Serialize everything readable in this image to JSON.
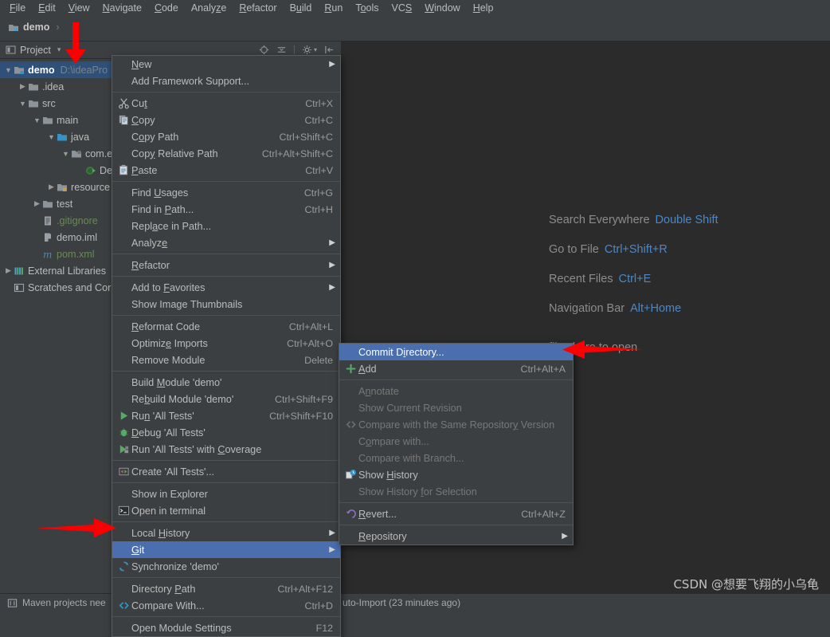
{
  "menubar": {
    "items": [
      "File",
      "Edit",
      "View",
      "Navigate",
      "Code",
      "Analyze",
      "Refactor",
      "Build",
      "Run",
      "Tools",
      "VCS",
      "Window",
      "Help"
    ]
  },
  "breadcrumb": {
    "project": "demo",
    "separator": "›"
  },
  "toolwindow": {
    "title": "Project",
    "dropdown_caret": "▾",
    "icons": [
      "locate-icon",
      "collapse-all-icon",
      "settings-gear-icon",
      "hide-icon"
    ]
  },
  "tree": [
    {
      "indent": 0,
      "twisty": "▼",
      "icon": "module-icon",
      "label": "demo",
      "path": "D:\\ideaPro",
      "selected": true,
      "bold": true
    },
    {
      "indent": 1,
      "twisty": "▶",
      "icon": "folder-icon",
      "label": ".idea",
      "path": "",
      "selected": false,
      "bold": false
    },
    {
      "indent": 1,
      "twisty": "▼",
      "icon": "folder-icon",
      "label": "src",
      "path": "",
      "selected": false,
      "bold": false
    },
    {
      "indent": 2,
      "twisty": "▼",
      "icon": "folder-icon",
      "label": "main",
      "path": "",
      "selected": false,
      "bold": false
    },
    {
      "indent": 3,
      "twisty": "▼",
      "icon": "source-folder-icon",
      "label": "java",
      "path": "",
      "selected": false,
      "bold": false
    },
    {
      "indent": 4,
      "twisty": "▼",
      "icon": "package-icon",
      "label": "com.e",
      "path": "",
      "selected": false,
      "bold": false
    },
    {
      "indent": 5,
      "twisty": "",
      "icon": "java-class-run-icon",
      "label": "De",
      "path": "",
      "selected": false,
      "bold": false
    },
    {
      "indent": 3,
      "twisty": "▶",
      "icon": "resources-folder-icon",
      "label": "resource",
      "path": "",
      "selected": false,
      "bold": false
    },
    {
      "indent": 2,
      "twisty": "▶",
      "icon": "folder-icon",
      "label": "test",
      "path": "",
      "selected": false,
      "bold": false
    },
    {
      "indent": 2,
      "twisty": "",
      "icon": "gitignore-file-icon",
      "label": ".gitignore",
      "path": "",
      "selected": false,
      "bold": false
    },
    {
      "indent": 2,
      "twisty": "",
      "icon": "iml-file-icon",
      "label": "demo.iml",
      "path": "",
      "selected": false,
      "bold": false
    },
    {
      "indent": 2,
      "twisty": "",
      "icon": "maven-pom-icon",
      "label": "pom.xml",
      "path": "",
      "selected": false,
      "bold": false
    },
    {
      "indent": 0,
      "twisty": "▶",
      "icon": "external-libraries-icon",
      "label": "External Libraries",
      "path": "",
      "selected": false,
      "bold": false
    },
    {
      "indent": 0,
      "twisty": "",
      "icon": "scratches-icon",
      "label": "Scratches and Cor",
      "path": "",
      "selected": false,
      "bold": false
    }
  ],
  "editor_hints": [
    {
      "label": "Search Everywhere",
      "key": "Double Shift"
    },
    {
      "label": "Go to File",
      "key": "Ctrl+Shift+R"
    },
    {
      "label": "Recent Files",
      "key": "Ctrl+E"
    },
    {
      "label": "Navigation Bar",
      "key": "Alt+Home"
    }
  ],
  "drop_hint": "files here to open",
  "context_menu": {
    "groups": [
      [
        {
          "icon": "",
          "label": "New",
          "accel": "",
          "submenu": true,
          "disabled": false,
          "highlighted": false,
          "mnemonic": 0
        },
        {
          "icon": "",
          "label": "Add Framework Support...",
          "accel": "",
          "submenu": false,
          "disabled": false,
          "highlighted": false,
          "mnemonic": -1
        }
      ],
      [
        {
          "icon": "cut-icon",
          "label": "Cut",
          "accel": "Ctrl+X",
          "submenu": false,
          "disabled": false,
          "highlighted": false,
          "mnemonic": 2
        },
        {
          "icon": "copy-icon",
          "label": "Copy",
          "accel": "Ctrl+C",
          "submenu": false,
          "disabled": false,
          "highlighted": false,
          "mnemonic": 0
        },
        {
          "icon": "",
          "label": "Copy Path",
          "accel": "Ctrl+Shift+C",
          "submenu": false,
          "disabled": false,
          "highlighted": false,
          "mnemonic": 1
        },
        {
          "icon": "",
          "label": "Copy Relative Path",
          "accel": "Ctrl+Alt+Shift+C",
          "submenu": false,
          "disabled": false,
          "highlighted": false,
          "mnemonic": 3
        },
        {
          "icon": "paste-icon",
          "label": "Paste",
          "accel": "Ctrl+V",
          "submenu": false,
          "disabled": false,
          "highlighted": false,
          "mnemonic": 0
        }
      ],
      [
        {
          "icon": "",
          "label": "Find Usages",
          "accel": "Ctrl+G",
          "submenu": false,
          "disabled": false,
          "highlighted": false,
          "mnemonic": 5
        },
        {
          "icon": "",
          "label": "Find in Path...",
          "accel": "Ctrl+H",
          "submenu": false,
          "disabled": false,
          "highlighted": false,
          "mnemonic": 8
        },
        {
          "icon": "",
          "label": "Replace in Path...",
          "accel": "",
          "submenu": false,
          "disabled": false,
          "highlighted": false,
          "mnemonic": 4
        },
        {
          "icon": "",
          "label": "Analyze",
          "accel": "",
          "submenu": true,
          "disabled": false,
          "highlighted": false,
          "mnemonic": 6
        }
      ],
      [
        {
          "icon": "",
          "label": "Refactor",
          "accel": "",
          "submenu": true,
          "disabled": false,
          "highlighted": false,
          "mnemonic": 0
        }
      ],
      [
        {
          "icon": "",
          "label": "Add to Favorites",
          "accel": "",
          "submenu": true,
          "disabled": false,
          "highlighted": false,
          "mnemonic": 7
        },
        {
          "icon": "",
          "label": "Show Image Thumbnails",
          "accel": "",
          "submenu": false,
          "disabled": false,
          "highlighted": false,
          "mnemonic": -1
        }
      ],
      [
        {
          "icon": "",
          "label": "Reformat Code",
          "accel": "Ctrl+Alt+L",
          "submenu": false,
          "disabled": false,
          "highlighted": false,
          "mnemonic": 0
        },
        {
          "icon": "",
          "label": "Optimize Imports",
          "accel": "Ctrl+Alt+O",
          "submenu": false,
          "disabled": false,
          "highlighted": false,
          "mnemonic": 7
        },
        {
          "icon": "",
          "label": "Remove Module",
          "accel": "Delete",
          "submenu": false,
          "disabled": false,
          "highlighted": false,
          "mnemonic": -1
        }
      ],
      [
        {
          "icon": "",
          "label": "Build Module 'demo'",
          "accel": "",
          "submenu": false,
          "disabled": false,
          "highlighted": false,
          "mnemonic": 6
        },
        {
          "icon": "",
          "label": "Rebuild Module 'demo'",
          "accel": "Ctrl+Shift+F9",
          "submenu": false,
          "disabled": false,
          "highlighted": false,
          "mnemonic": 2
        },
        {
          "icon": "run-icon",
          "label": "Run 'All Tests'",
          "accel": "Ctrl+Shift+F10",
          "submenu": false,
          "disabled": false,
          "highlighted": false,
          "mnemonic": 2
        },
        {
          "icon": "debug-icon",
          "label": "Debug 'All Tests'",
          "accel": "",
          "submenu": false,
          "disabled": false,
          "highlighted": false,
          "mnemonic": 0
        },
        {
          "icon": "coverage-icon",
          "label": "Run 'All Tests' with Coverage",
          "accel": "",
          "submenu": false,
          "disabled": false,
          "highlighted": false,
          "mnemonic": 21
        }
      ],
      [
        {
          "icon": "create-config-icon",
          "label": "Create 'All Tests'...",
          "accel": "",
          "submenu": false,
          "disabled": false,
          "highlighted": false,
          "mnemonic": -1
        }
      ],
      [
        {
          "icon": "",
          "label": "Show in Explorer",
          "accel": "",
          "submenu": false,
          "disabled": false,
          "highlighted": false,
          "mnemonic": -1
        },
        {
          "icon": "terminal-icon",
          "label": "Open in terminal",
          "accel": "",
          "submenu": false,
          "disabled": false,
          "highlighted": false,
          "mnemonic": -1
        }
      ],
      [
        {
          "icon": "",
          "label": "Local History",
          "accel": "",
          "submenu": true,
          "disabled": false,
          "highlighted": false,
          "mnemonic": 6
        },
        {
          "icon": "",
          "label": "Git",
          "accel": "",
          "submenu": true,
          "disabled": false,
          "highlighted": true,
          "mnemonic": 0
        },
        {
          "icon": "synchronize-icon",
          "label": "Synchronize 'demo'",
          "accel": "",
          "submenu": false,
          "disabled": false,
          "highlighted": false,
          "mnemonic": -1
        }
      ],
      [
        {
          "icon": "",
          "label": "Directory Path",
          "accel": "Ctrl+Alt+F12",
          "submenu": false,
          "disabled": false,
          "highlighted": false,
          "mnemonic": 10
        },
        {
          "icon": "compare-icon",
          "label": "Compare With...",
          "accel": "Ctrl+D",
          "submenu": false,
          "disabled": false,
          "highlighted": false,
          "mnemonic": -1
        }
      ],
      [
        {
          "icon": "",
          "label": "Open Module Settings",
          "accel": "F12",
          "submenu": false,
          "disabled": false,
          "highlighted": false,
          "mnemonic": -1
        }
      ]
    ]
  },
  "git_submenu": {
    "groups": [
      [
        {
          "icon": "",
          "label": "Commit Directory...",
          "accel": "",
          "submenu": false,
          "disabled": false,
          "highlighted": true,
          "mnemonic": 8
        },
        {
          "icon": "add-icon",
          "label": "Add",
          "accel": "Ctrl+Alt+A",
          "submenu": false,
          "disabled": false,
          "highlighted": false,
          "mnemonic": 0
        }
      ],
      [
        {
          "icon": "",
          "label": "Annotate",
          "accel": "",
          "submenu": false,
          "disabled": true,
          "highlighted": false,
          "mnemonic": 1
        },
        {
          "icon": "",
          "label": "Show Current Revision",
          "accel": "",
          "submenu": false,
          "disabled": true,
          "highlighted": false,
          "mnemonic": -1
        },
        {
          "icon": "compare-icon-dim",
          "label": "Compare with the Same Repository Version",
          "accel": "",
          "submenu": false,
          "disabled": true,
          "highlighted": false,
          "mnemonic": 31
        },
        {
          "icon": "",
          "label": "Compare with...",
          "accel": "",
          "submenu": false,
          "disabled": true,
          "highlighted": false,
          "mnemonic": 1
        },
        {
          "icon": "",
          "label": "Compare with Branch...",
          "accel": "",
          "submenu": false,
          "disabled": true,
          "highlighted": false,
          "mnemonic": -1
        },
        {
          "icon": "show-history-icon",
          "label": "Show History",
          "accel": "",
          "submenu": false,
          "disabled": false,
          "highlighted": false,
          "mnemonic": 5
        },
        {
          "icon": "",
          "label": "Show History for Selection",
          "accel": "",
          "submenu": false,
          "disabled": true,
          "highlighted": false,
          "mnemonic": 13
        }
      ],
      [
        {
          "icon": "revert-icon",
          "label": "Revert...",
          "accel": "Ctrl+Alt+Z",
          "submenu": false,
          "disabled": false,
          "highlighted": false,
          "mnemonic": 0
        }
      ],
      [
        {
          "icon": "",
          "label": "Repository",
          "accel": "",
          "submenu": true,
          "disabled": false,
          "highlighted": false,
          "mnemonic": 0
        }
      ]
    ]
  },
  "statusbar": {
    "left_text": "Maven projects nee",
    "right_text": "uto-Import (23 minutes ago)"
  },
  "watermark": "CSDN @想要飞翔的小乌龟",
  "colors": {
    "window_bg": "#3c3f41",
    "editor_bg": "#2b2b2b",
    "menu_bg": "#3c3f41",
    "highlight": "#4b6eaf",
    "tree_selection": "#2f5179",
    "accent_link": "#4a88c7",
    "annotation_arrow": "#fb0000",
    "green_text": "#6a8759"
  }
}
